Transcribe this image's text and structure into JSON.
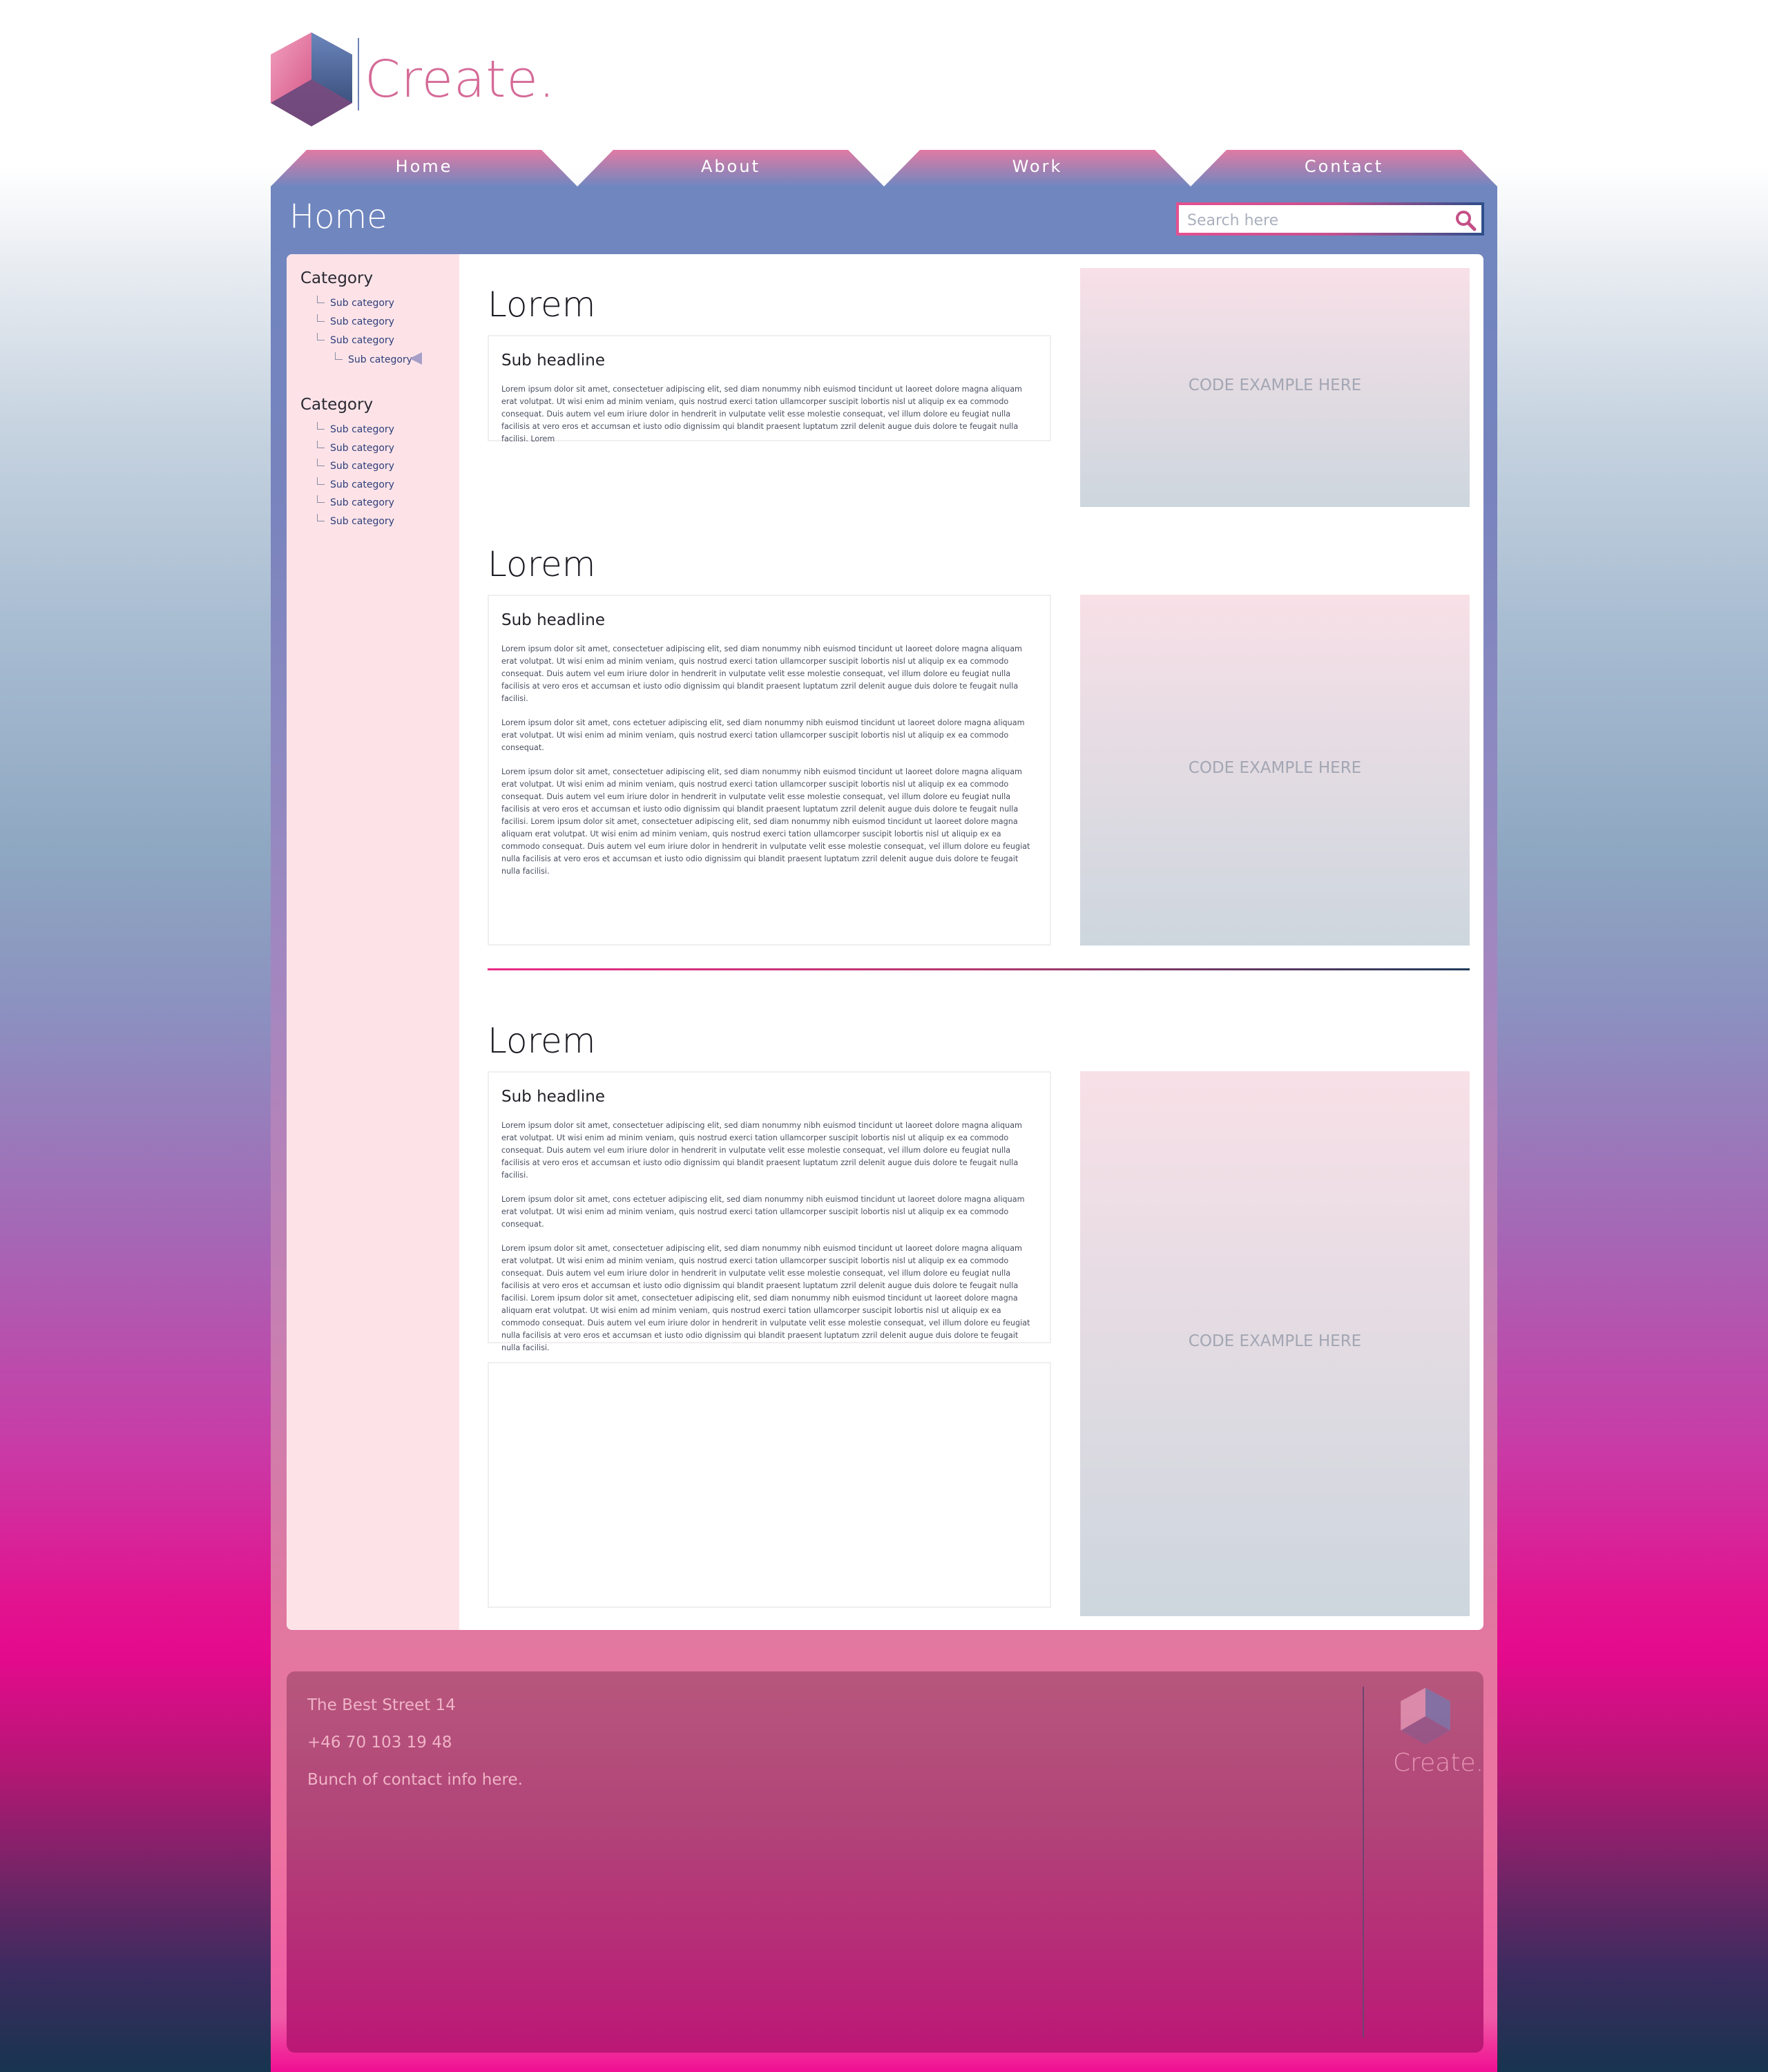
{
  "brand": {
    "name": "Create."
  },
  "nav": {
    "tabs": [
      {
        "label": "Home"
      },
      {
        "label": "About"
      },
      {
        "label": "Work"
      },
      {
        "label": "Contact"
      }
    ]
  },
  "page": {
    "title": "Home"
  },
  "search": {
    "placeholder": "Search here"
  },
  "sidebar": {
    "groups": [
      {
        "title": "Category",
        "items": [
          "Sub category",
          "Sub category",
          "Sub category",
          "Sub category"
        ]
      },
      {
        "title": "Category",
        "items": [
          "Sub category",
          "Sub category",
          "Sub category",
          "Sub category",
          "Sub category",
          "Sub category"
        ]
      }
    ]
  },
  "sections": [
    {
      "title": "Lorem",
      "subheadline": "Sub headline",
      "paragraphs": [
        "Lorem ipsum dolor sit amet, consectetuer adipiscing elit, sed diam nonummy nibh euismod tincidunt ut laoreet dolore magna aliquam erat volutpat. Ut wisi enim ad minim veniam, quis nostrud exerci tation ullamcorper suscipit lobortis nisl ut aliquip ex ea commodo consequat. Duis autem vel eum iriure dolor in hendrerit in vulputate velit esse molestie consequat, vel illum dolore eu feugiat nulla facilisis at vero eros et accumsan et iusto odio dignissim qui blandit praesent luptatum zzril delenit augue duis dolore te feugait nulla facilisi. Lorem"
      ],
      "code_label": "CODE EXAMPLE HERE"
    },
    {
      "title": "Lorem",
      "subheadline": "Sub headline",
      "paragraphs": [
        "Lorem ipsum dolor sit amet, consectetuer adipiscing elit, sed diam nonummy nibh euismod tincidunt ut laoreet dolore magna aliquam erat volutpat. Ut wisi enim ad minim veniam, quis nostrud exerci tation ullamcorper suscipit lobortis nisl ut aliquip ex ea commodo consequat. Duis autem vel eum iriure dolor in hendrerit in vulputate velit esse molestie consequat, vel illum dolore eu feugiat nulla facilisis at vero eros et accumsan et iusto odio dignissim qui blandit praesent luptatum zzril delenit augue duis dolore te feugait nulla facilisi.",
        "Lorem ipsum dolor sit amet, cons ectetuer adipiscing elit, sed diam nonummy nibh euismod tincidunt ut laoreet dolore magna aliquam erat volutpat. Ut wisi enim ad minim veniam, quis nostrud exerci tation ullamcorper suscipit lobortis nisl ut aliquip ex ea commodo consequat.",
        "Lorem ipsum dolor sit amet, consectetuer adipiscing elit, sed diam nonummy nibh euismod tincidunt ut laoreet dolore magna aliquam erat volutpat. Ut wisi enim ad minim veniam, quis nostrud exerci tation ullamcorper suscipit lobortis nisl ut aliquip ex ea commodo consequat. Duis autem vel eum iriure dolor in hendrerit in vulputate velit esse molestie consequat, vel illum dolore eu feugiat nulla facilisis at vero eros et accumsan et iusto odio dignissim qui blandit praesent luptatum zzril delenit augue duis dolore te feugait nulla facilisi. Lorem ipsum dolor sit amet, consectetuer adipiscing elit, sed diam nonummy nibh euismod tincidunt ut laoreet dolore magna aliquam erat volutpat. Ut wisi enim ad minim veniam, quis nostrud exerci tation ullamcorper suscipit lobortis nisl ut aliquip ex ea commodo consequat. Duis autem vel eum iriure dolor in hendrerit in vulputate velit esse molestie consequat, vel illum dolore eu feugiat nulla facilisis at vero eros et accumsan et iusto odio dignissim qui blandit praesent luptatum zzril delenit augue duis dolore te feugait nulla facilisi."
      ],
      "code_label": "CODE EXAMPLE HERE"
    },
    {
      "title": "Lorem",
      "subheadline": "Sub headline",
      "paragraphs": [
        "Lorem ipsum dolor sit amet, consectetuer adipiscing elit, sed diam nonummy nibh euismod tincidunt ut laoreet dolore magna aliquam erat volutpat. Ut wisi enim ad minim veniam, quis nostrud exerci tation ullamcorper suscipit lobortis nisl ut aliquip ex ea commodo consequat. Duis autem vel eum iriure dolor in hendrerit in vulputate velit esse molestie consequat, vel illum dolore eu feugiat nulla facilisis at vero eros et accumsan et iusto odio dignissim qui blandit praesent luptatum zzril delenit augue duis dolore te feugait nulla facilisi.",
        "Lorem ipsum dolor sit amet, cons ectetuer adipiscing elit, sed diam nonummy nibh euismod tincidunt ut laoreet dolore magna aliquam erat volutpat. Ut wisi enim ad minim veniam, quis nostrud exerci tation ullamcorper suscipit lobortis nisl ut aliquip ex ea commodo consequat.",
        "Lorem ipsum dolor sit amet, consectetuer adipiscing elit, sed diam nonummy nibh euismod tincidunt ut laoreet dolore magna aliquam erat volutpat. Ut wisi enim ad minim veniam, quis nostrud exerci tation ullamcorper suscipit lobortis nisl ut aliquip ex ea commodo consequat. Duis autem vel eum iriure dolor in hendrerit in vulputate velit esse molestie consequat, vel illum dolore eu feugiat nulla facilisis at vero eros et accumsan et iusto odio dignissim qui blandit praesent luptatum zzril delenit augue duis dolore te feugait nulla facilisi. Lorem ipsum dolor sit amet, consectetuer adipiscing elit, sed diam nonummy nibh euismod tincidunt ut laoreet dolore magna aliquam erat volutpat. Ut wisi enim ad minim veniam, quis nostrud exerci tation ullamcorper suscipit lobortis nisl ut aliquip ex ea commodo consequat. Duis autem vel eum iriure dolor in hendrerit in vulputate velit esse molestie consequat, vel illum dolore eu feugiat nulla facilisis at vero eros et accumsan et iusto odio dignissim qui blandit praesent luptatum zzril delenit augue duis dolore te feugait nulla facilisi."
      ],
      "code_label": "CODE EXAMPLE HERE"
    }
  ],
  "footer": {
    "address": "The Best Street 14",
    "phone": "+46 70 103 19 48",
    "info": "Bunch of contact info here.",
    "brand": "Create."
  },
  "colors": {
    "accent": "#e3508f",
    "nav": "#6f86bf",
    "sidebar": "#fde3e8",
    "footer": "#b7577d"
  },
  "icons": {
    "search": "search-icon",
    "logo": "cube-logo-icon",
    "active": "triangle-left-icon"
  }
}
